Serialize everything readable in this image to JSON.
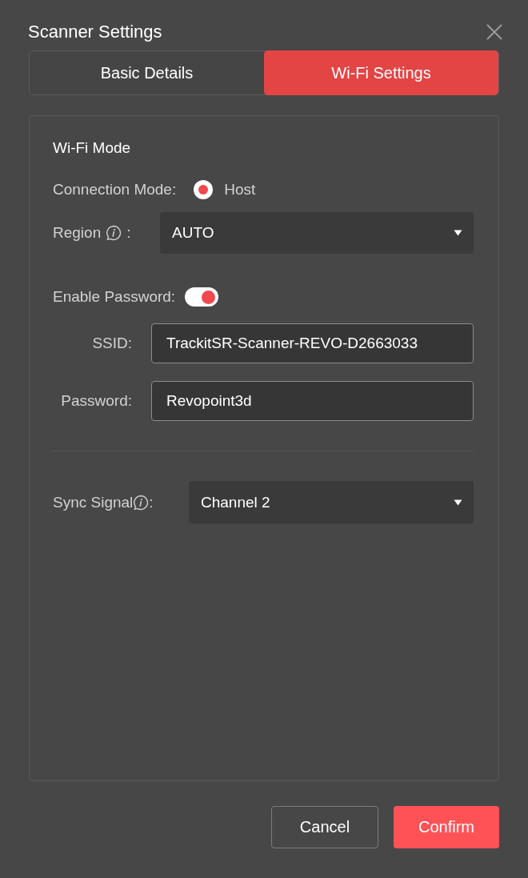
{
  "dialog": {
    "title": "Scanner Settings"
  },
  "tabs": [
    {
      "label": "Basic Details",
      "selected": false
    },
    {
      "label": "Wi-Fi Settings",
      "selected": true
    }
  ],
  "wifi_mode": {
    "heading": "Wi-Fi Mode",
    "connection_mode": {
      "label": "Connection Mode:",
      "options": [
        {
          "label": "Host",
          "selected": true
        }
      ]
    },
    "region": {
      "label": "Region",
      "suffix": ":",
      "value": "AUTO"
    },
    "enable_password": {
      "label": "Enable Password:",
      "on": true
    },
    "ssid": {
      "label": "SSID:",
      "value": "TrackitSR-Scanner-REVO-D2663033"
    },
    "password": {
      "label": "Password:",
      "value": "Revopoint3d"
    }
  },
  "sync_signal": {
    "label": "Sync Signal",
    "suffix": ":",
    "value": "Channel 2"
  },
  "buttons": [
    {
      "label": "Cancel",
      "kind": "secondary"
    },
    {
      "label": "Confirm",
      "kind": "primary"
    }
  ]
}
